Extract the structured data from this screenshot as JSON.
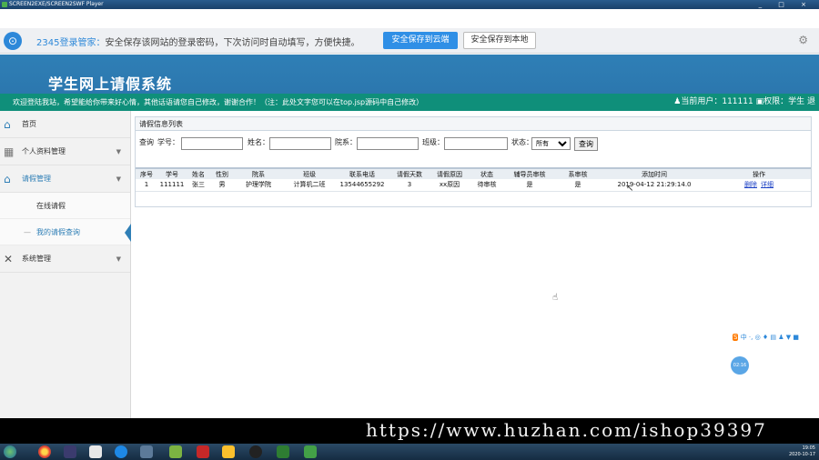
{
  "player": {
    "title": "SCREEN2EXE/SCREEN2SWF Player",
    "controls": "_ □ ×"
  },
  "pw_bar": {
    "brand": "2345登录管家：",
    "message": "安全保存该网站的登录密码，下次访问时自动填写，方便快捷。",
    "save_cloud": "安全保存到云端",
    "save_local": "安全保存到本地"
  },
  "site": {
    "title": "学生网上请假系统",
    "notice": "欢迎登陆我站，希望能给你带来好心情，其他话语请您自己修改，谢谢合作！（注：此处文字您可以在top.jsp源码中自己修改）",
    "current_user_label": "当前用户：",
    "current_user": "111111",
    "permission_label": "权限：",
    "permission": "学生 退"
  },
  "sidebar": {
    "items": [
      {
        "label": "首页"
      },
      {
        "label": "个人资料管理"
      },
      {
        "label": "请假管理"
      },
      {
        "label": "在线请假"
      },
      {
        "label": "我的请假查询"
      },
      {
        "label": "系统管理"
      }
    ]
  },
  "panel": {
    "title": "请假信息列表",
    "search": {
      "query_label": "查询",
      "student_id_label": "学号：",
      "name_label": "姓名：",
      "dept_label": "院系：",
      "class_label": "班级：",
      "status_label": "状态：",
      "status_value": "所有",
      "search_button": "查询"
    },
    "columns": [
      "序号",
      "学号",
      "姓名",
      "性别",
      "院系",
      "班级",
      "联系电话",
      "请假天数",
      "请假原因",
      "状态",
      "辅导员审核",
      "系审核",
      "添加时间",
      "操作"
    ],
    "rows": [
      {
        "cells": [
          "1",
          "111111",
          "张三",
          "男",
          "护理学院",
          "计算机二班",
          "13544655292",
          "3",
          "xx原因",
          "待审核",
          "是",
          "是",
          "2019-04-12 21:29:14.0"
        ],
        "actions": [
          "删除",
          "详细"
        ]
      }
    ]
  },
  "ime": {
    "label": "中 ·, ◎ ♦ ▤ ♟ ▼ ■"
  },
  "timer": {
    "label": "02:16"
  },
  "watermark": {
    "text": "https://www.huzhan.com/ishop39397"
  },
  "tray": {
    "time": "19:05",
    "date": "2020-10-17"
  }
}
